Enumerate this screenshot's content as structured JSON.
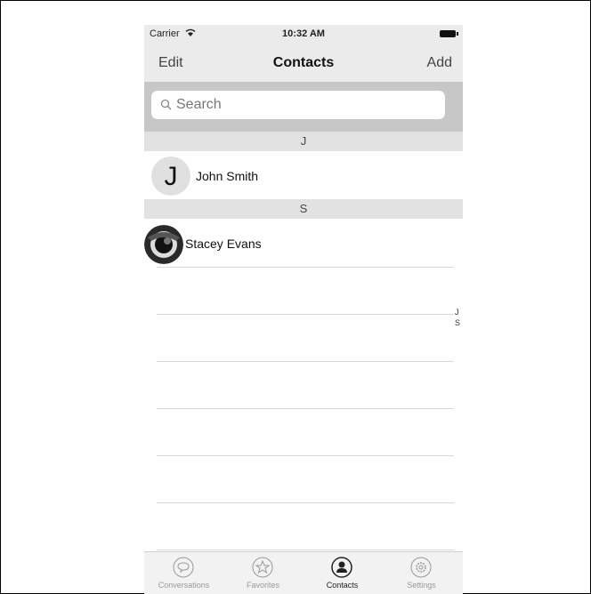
{
  "status_bar": {
    "carrier": "Carrier",
    "time": "10:32 AM"
  },
  "nav": {
    "edit_label": "Edit",
    "title": "Contacts",
    "add_label": "Add"
  },
  "search": {
    "placeholder": "Search"
  },
  "sections": [
    {
      "letter": "J",
      "contacts": [
        {
          "name": "John Smith",
          "initial": "J",
          "avatar": "letter"
        }
      ]
    },
    {
      "letter": "S",
      "contacts": [
        {
          "name": "Stacey Evans",
          "avatar": "photo"
        }
      ]
    }
  ],
  "index_letters": [
    "J",
    "S"
  ],
  "tabs": [
    {
      "label": "Conversations",
      "icon": "chat-bubble-icon",
      "active": false
    },
    {
      "label": "Favorites",
      "icon": "star-icon",
      "active": false
    },
    {
      "label": "Contacts",
      "icon": "person-icon",
      "active": true
    },
    {
      "label": "Settings",
      "icon": "gear-icon",
      "active": false
    }
  ]
}
